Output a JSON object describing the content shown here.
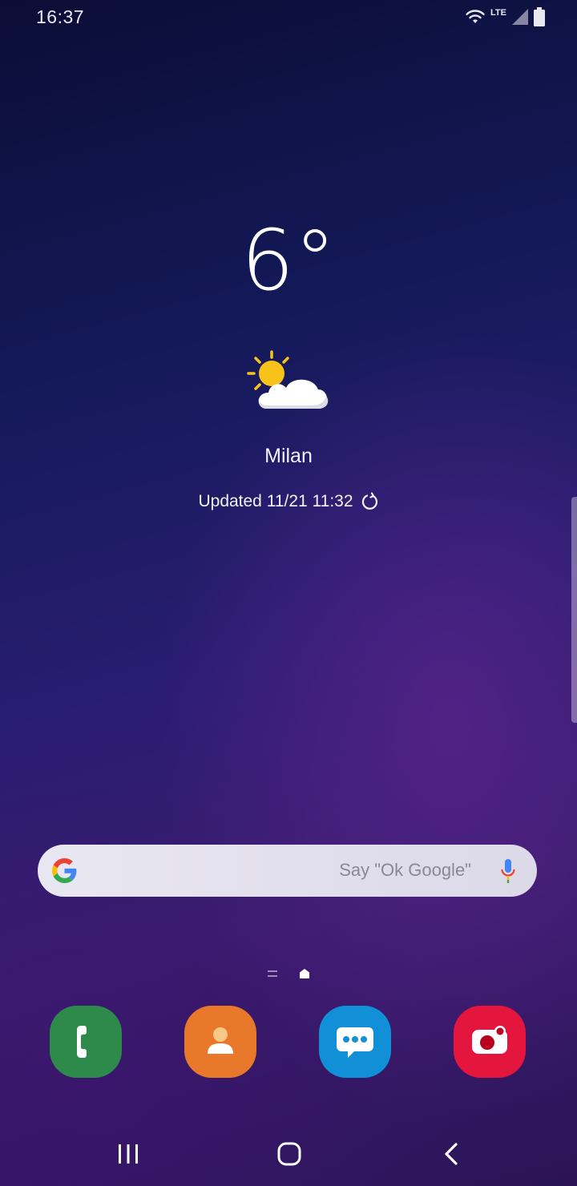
{
  "status_bar": {
    "time": "16:37",
    "network_label": "LTE",
    "icons": [
      "wifi-icon",
      "lte-icon",
      "signal-icon",
      "battery-icon"
    ]
  },
  "weather": {
    "temperature": "6°",
    "condition_icon": "partly-cloudy-icon",
    "city": "Milan",
    "updated": "Updated 11/21 11:32",
    "refresh_icon": "refresh-icon"
  },
  "search": {
    "placeholder": "Say \"Ok Google\"",
    "logo": "google-logo",
    "mic_icon": "mic-icon"
  },
  "page_indicator": {
    "pages": [
      "lines-indicator",
      "home-indicator"
    ],
    "active": "home-indicator"
  },
  "dock": {
    "apps": [
      {
        "name": "Phone",
        "icon": "phone-icon",
        "color": "#2e8a4a"
      },
      {
        "name": "Contacts",
        "icon": "contacts-icon",
        "color": "#e8782a"
      },
      {
        "name": "Messages",
        "icon": "messages-icon",
        "color": "#1190d8"
      },
      {
        "name": "Camera",
        "icon": "camera-icon",
        "color": "#e4163e"
      }
    ]
  },
  "nav_bar": {
    "buttons": [
      "recents-icon",
      "home-icon",
      "back-icon"
    ]
  },
  "colors": {
    "background_top": "#0b0d36",
    "background_bottom": "#3a1c6e",
    "search_bar": "#e9e7f1",
    "text": "#ffffff"
  }
}
